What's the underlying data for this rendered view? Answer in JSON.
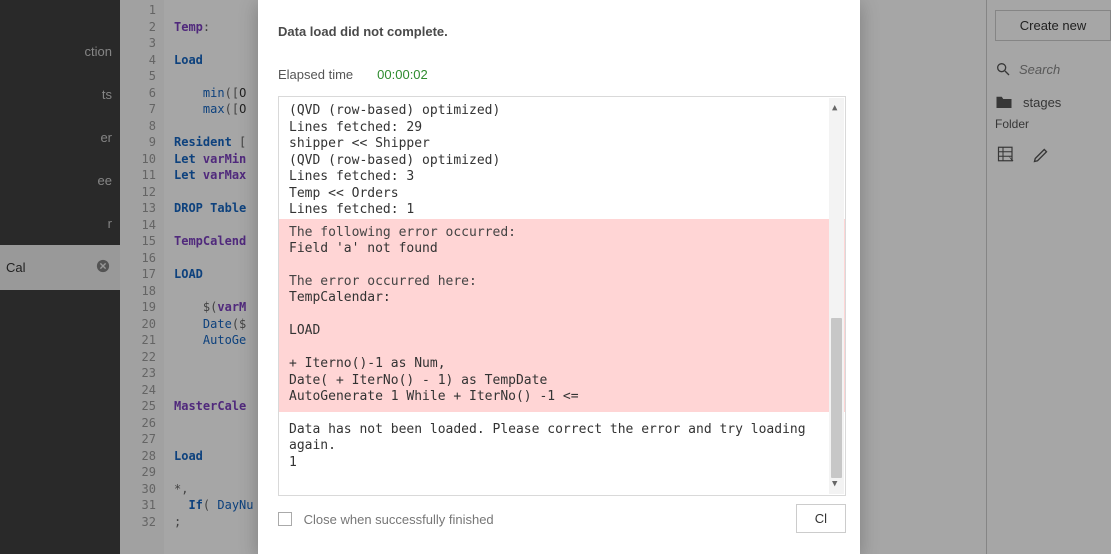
{
  "sidebar": {
    "items": [
      {
        "label": "ction"
      },
      {
        "label": "ts"
      },
      {
        "label": "er"
      },
      {
        "label": "ee"
      },
      {
        "label": "r"
      }
    ],
    "active": {
      "label": "Cal"
    }
  },
  "editor": {
    "line_start": 1,
    "line_count": 32,
    "lines": [
      "",
      "Temp:",
      "",
      "Load",
      "",
      "    min([O",
      "    max([O",
      "",
      "Resident [",
      "Let varMin",
      "Let varMax",
      "",
      "DROP Table",
      "",
      "TempCalend",
      "",
      "LOAD",
      "",
      "    $(varM",
      "    Date($",
      "    AutoGe",
      "",
      "",
      "",
      "MasterCale",
      "",
      "",
      "Load",
      "",
      "*,",
      "  If( DayNu",
      ";"
    ]
  },
  "modal": {
    "title": "Data load did not complete.",
    "elapsed_label": "Elapsed time",
    "elapsed_value": "00:00:02",
    "log_pre": [
      "(QVD (row-based) optimized)",
      "Lines fetched: 29",
      "shipper << Shipper",
      "(QVD (row-based) optimized)",
      "Lines fetched: 3",
      "Temp << Orders",
      "Lines fetched: 1"
    ],
    "error_head1": "The following error occurred:",
    "error_body1": "Field 'a' not found",
    "error_head2": "The error occurred here:",
    "error_body2": [
      "TempCalendar:",
      "",
      "LOAD",
      "",
      "     + Iterno()-1 as Num,",
      "    Date( + IterNo() - 1) as TempDate",
      "    AutoGenerate 1 While  + IterNo() -1 <="
    ],
    "log_post": [
      "Data has not been loaded. Please correct the error and try loading again.",
      "1"
    ],
    "close_when_finished": "Close when successfully finished",
    "close_btn": "Cl"
  },
  "right": {
    "create_btn": "Create new",
    "search_placeholder": "Search",
    "folder_name": "stages",
    "folder_label": "Folder"
  }
}
